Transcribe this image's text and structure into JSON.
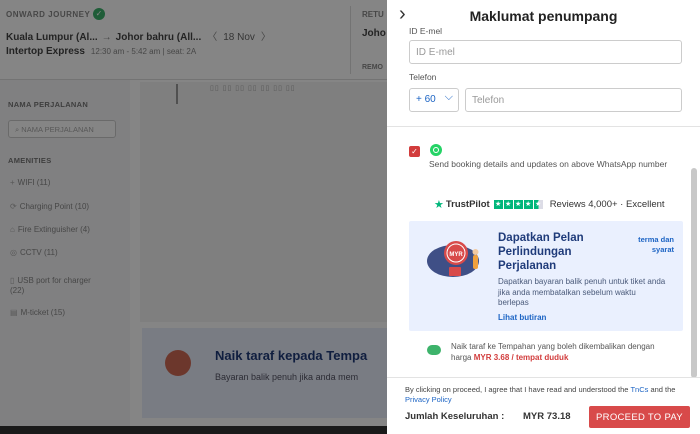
{
  "background": {
    "journey_label": "ONWARD JOURNEY",
    "route_from": "Kuala Lumpur (Al...",
    "route_arrow": "→",
    "route_to": "Johor bahru (All...",
    "date_prev": "〈",
    "date": "18 Nov",
    "date_next": "〉",
    "operator": "Intertop Express",
    "operator_details": "12:30 am - 5:42 am  |  seat: 2A",
    "return_label": "RETU",
    "return_route": "Joho",
    "return_remove": "REMO",
    "sidebar": {
      "name_title": "NAMA PERJALANAN",
      "search_placeholder": "NAMA PERJALANAN",
      "amenities_title": "AMENITIES",
      "amenities": [
        {
          "icon": "+",
          "label": "WIFI (11)"
        },
        {
          "icon": "⟳",
          "label": "Charging Point (10)"
        },
        {
          "icon": "⌂",
          "label": "Fire Extinguisher (4)"
        },
        {
          "icon": "◎",
          "label": "CCTV (11)"
        },
        {
          "icon": "▯",
          "label": "USB port for charger"
        },
        {
          "icon": "",
          "label": "(22)"
        },
        {
          "icon": "▤",
          "label": "M-ticket (15)"
        }
      ]
    },
    "promo_title": "Naik taraf kepada Tempa",
    "promo_sub": "Bayaran balik penuh jika anda mem"
  },
  "panel": {
    "title": "Maklumat penumpang",
    "email_label": "ID E-mel",
    "email_placeholder": "ID E-mel",
    "phone_label": "Telefon",
    "country_code": "+ 60",
    "phone_placeholder": "Telefon",
    "whatsapp_text": "Send booking details and updates on above WhatsApp number",
    "trustpilot": {
      "name": "TrustPilot",
      "reviews": "Reviews 4,000+ · Excellent"
    },
    "insurance": {
      "title": "Dapatkan Pelan Perlindungan Perjalanan",
      "terms": "terma dan syarat",
      "desc": "Dapatkan bayaran balik penuh untuk tiket anda jika anda membatalkan sebelum waktu berlepas",
      "link": "Lihat butiran",
      "badge": "MYR"
    },
    "upgrade": {
      "text": "Naik taraf ke Tempahan yang boleh dikembalikan dengan harga",
      "price": "MYR 3.68 / tempat duduk"
    },
    "consent_prefix": "By clicking on proceed, I agree that I have read and understood the",
    "consent_tncs": "TnCs",
    "consent_and": "and the",
    "consent_privacy": "Privacy Policy",
    "total_label": "Jumlah Keseluruhan :",
    "total_value": "MYR  73.18",
    "proceed": "PROCEED TO PAY"
  },
  "colors": {
    "accent": "#1c64c4",
    "proceed": "#d84a4a",
    "trustpilot": "#00b67a",
    "whatsapp": "#25d366",
    "card_bg": "#eaf0fe"
  }
}
